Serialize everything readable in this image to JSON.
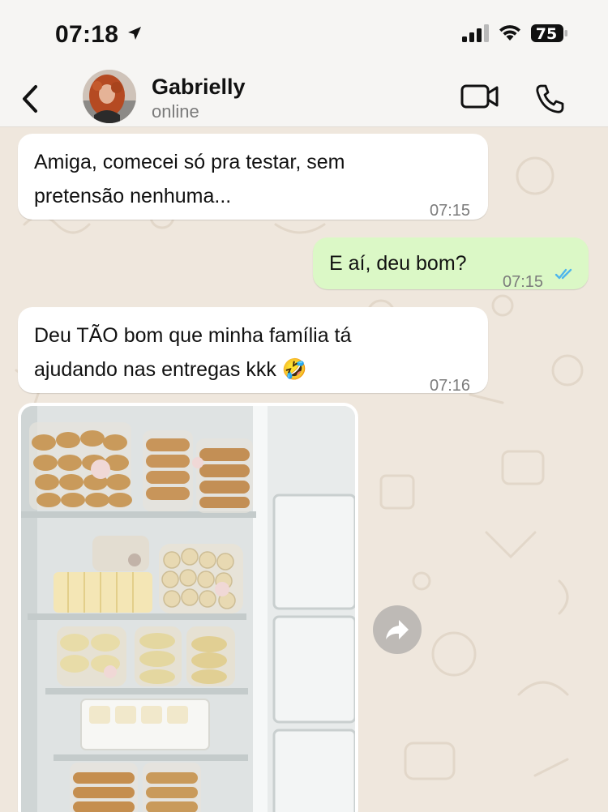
{
  "status_bar": {
    "time": "07:18",
    "battery_level": "75"
  },
  "header": {
    "contact_name": "Gabrielly",
    "contact_status": "online"
  },
  "messages": [
    {
      "direction": "incoming",
      "text": "Amiga, comecei só pra testar, sem\npretensão nenhuma...",
      "time": "07:15"
    },
    {
      "direction": "outgoing",
      "text": "E aí, deu bom?",
      "time": "07:15",
      "status": "read"
    },
    {
      "direction": "incoming",
      "text": "Deu TÃO bom que minha família tá\najudando nas entregas kkk 🤣",
      "time": "07:16"
    },
    {
      "direction": "incoming",
      "type": "image",
      "image_description": "freezer-with-packaged-pastries"
    }
  ],
  "icons": {
    "back": "chevron-left-icon",
    "video": "video-call-icon",
    "phone": "phone-call-icon",
    "forward": "forward-arrow-icon",
    "location": "location-arrow-icon"
  },
  "colors": {
    "incoming_bubble": "#ffffff",
    "outgoing_bubble": "#dbf8c6",
    "read_ticks": "#4fb6ec",
    "wallpaper": "#efe7dd"
  }
}
